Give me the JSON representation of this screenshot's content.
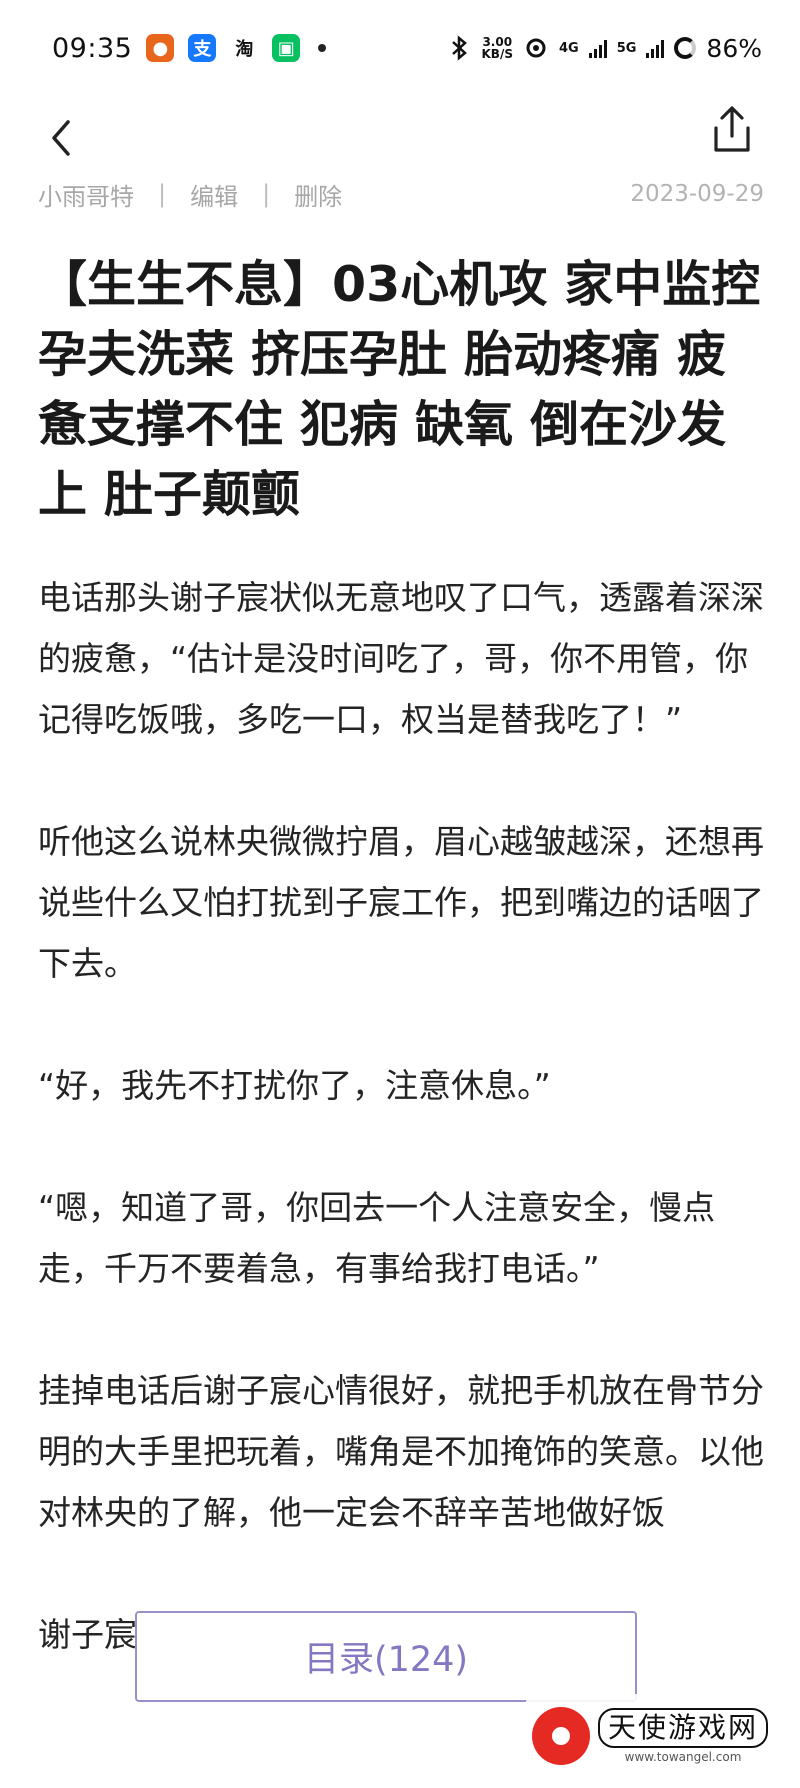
{
  "status_bar": {
    "time": "09:35",
    "app_icons": [
      "pumpkin-app-icon",
      "alipay-icon",
      "taobao-icon",
      "wechat-icon"
    ],
    "alipay_glyph": "支",
    "taobao_glyph": "淘",
    "network_speed_value": "3.00",
    "network_speed_unit": "KB/S",
    "network_1": "4G",
    "network_2": "5G",
    "battery": "86%"
  },
  "meta": {
    "author": "小雨哥特",
    "separator": "|",
    "edit": "编辑",
    "delete": "删除",
    "date": "2023-09-29"
  },
  "article": {
    "title": "【生生不息】03心机攻 家中监控 孕夫洗菜 挤压孕肚 胎动疼痛 疲惫支撑不住 犯病 缺氧 倒在沙发上 肚子颠颤",
    "paragraphs": [
      "电话那头谢子宸状似无意地叹了口气，透露着深深的疲惫，“估计是没时间吃了，哥，你不用管，你记得吃饭哦，多吃一口，权当是替我吃了！”",
      "听他这么说林央微微拧眉，眉心越皱越深，还想再说些什么又怕打扰到子宸工作，把到嘴边的话咽了下去。",
      "“好，我先不打扰你了，注意休息。”",
      "“嗯，知道了哥，你回去一个人注意安全，慢点走，千万不要着急，有事给我打电话。”",
      "挂掉电话后谢子宸心情很好，就把手机放在骨节分明的大手里把玩着，嘴角是不加掩饰的笑意。以他对林央的了解，他一定会不辞辛苦地做好饭",
      "谢子宸估算着林央回到家的时间，"
    ]
  },
  "toc_button": {
    "label": "目录(124)"
  },
  "watermark": {
    "name": "天使游戏网",
    "url": "www.towangel.com"
  },
  "colors": {
    "accent": "#8577c2",
    "meta_gray": "#a7a7a7",
    "title": "#1a1a1a"
  }
}
